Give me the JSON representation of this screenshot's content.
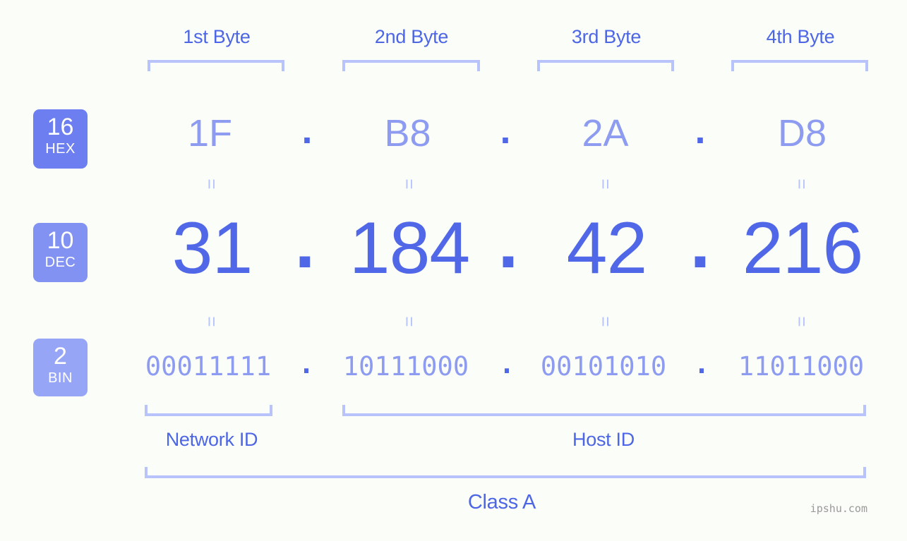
{
  "background": "#fbfdf8",
  "colors": {
    "accent_strong": "#5068e8",
    "accent_label": "#4d66e6",
    "accent_light": "#8d9cf0",
    "bracket": "#b8c3fb",
    "badge_hex": "#6d7ff0",
    "badge_dec": "#8292f3",
    "badge_bin": "#97a5f6",
    "watermark": "#9a9a9a"
  },
  "byte_headers": [
    {
      "label": "1st Byte"
    },
    {
      "label": "2nd Byte"
    },
    {
      "label": "3rd Byte"
    },
    {
      "label": "4th Byte"
    }
  ],
  "rows": {
    "hex": {
      "badge_base": "16",
      "badge_name": "HEX",
      "values": [
        "1F",
        "B8",
        "2A",
        "D8"
      ],
      "separator": "."
    },
    "dec": {
      "badge_base": "10",
      "badge_name": "DEC",
      "values": [
        "31",
        "184",
        "42",
        "216"
      ],
      "separator": "."
    },
    "bin": {
      "badge_base": "2",
      "badge_name": "BIN",
      "values": [
        "00011111",
        "10111000",
        "00101010",
        "11011000"
      ],
      "separator": "."
    }
  },
  "equivalence_symbol": "=",
  "footer": {
    "network_id_label": "Network ID",
    "host_id_label": "Host ID",
    "class_label": "Class A"
  },
  "watermark": "ipshu.com"
}
